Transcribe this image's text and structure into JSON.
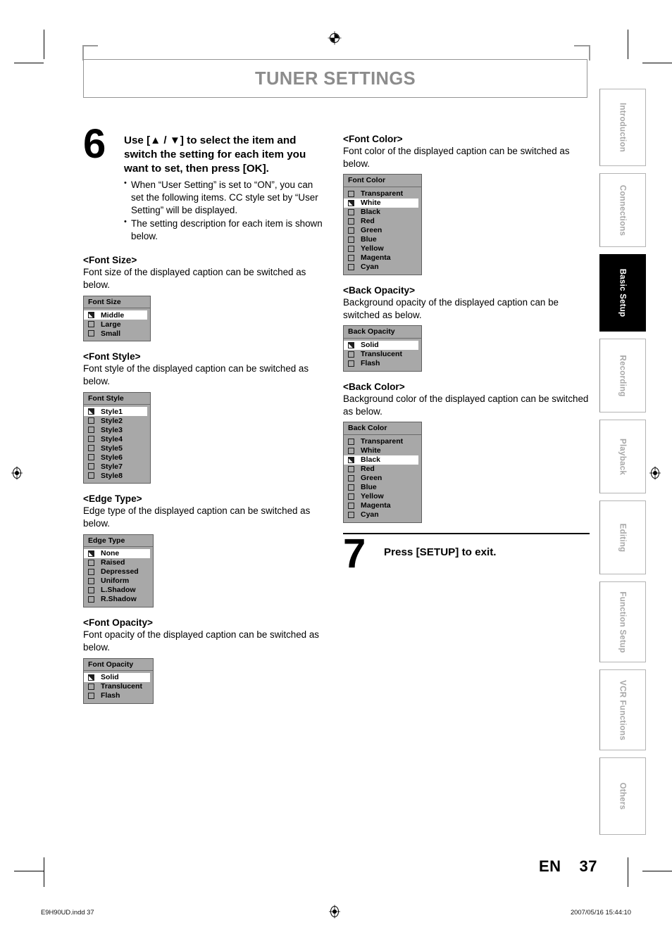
{
  "header": {
    "title": "TUNER SETTINGS"
  },
  "steps": {
    "six": {
      "number": "6",
      "heading": "Use [▲ / ▼] to select the item and switch the setting for each item you want to set, then press [OK].",
      "bullets": [
        "When “User Setting” is set to “ON”, you can set the following items. CC style set by “User Setting” will be displayed.",
        "The setting description for each item is shown below."
      ]
    },
    "seven": {
      "number": "7",
      "heading": "Press [SETUP] to exit."
    }
  },
  "sections": [
    {
      "title": "<Font Size>",
      "description": "Font size of the displayed caption can be switched as below.",
      "menu_title": "Font Size",
      "options": [
        {
          "label": "Middle",
          "checked": true
        },
        {
          "label": "Large",
          "checked": false
        },
        {
          "label": "Small",
          "checked": false
        }
      ]
    },
    {
      "title": "<Font Style>",
      "description": "Font style of the displayed caption can be switched as below.",
      "menu_title": "Font Style",
      "options": [
        {
          "label": "Style1",
          "checked": true
        },
        {
          "label": "Style2",
          "checked": false
        },
        {
          "label": "Style3",
          "checked": false
        },
        {
          "label": "Style4",
          "checked": false
        },
        {
          "label": "Style5",
          "checked": false
        },
        {
          "label": "Style6",
          "checked": false
        },
        {
          "label": "Style7",
          "checked": false
        },
        {
          "label": "Style8",
          "checked": false
        }
      ]
    },
    {
      "title": "<Edge Type>",
      "description": "Edge type of the displayed caption can be switched as below.",
      "menu_title": "Edge Type",
      "options": [
        {
          "label": "None",
          "checked": true
        },
        {
          "label": "Raised",
          "checked": false
        },
        {
          "label": "Depressed",
          "checked": false
        },
        {
          "label": "Uniform",
          "checked": false
        },
        {
          "label": "L.Shadow",
          "checked": false
        },
        {
          "label": "R.Shadow",
          "checked": false
        }
      ]
    },
    {
      "title": "<Font Opacity>",
      "description": "Font opacity of the displayed caption can be switched as below.",
      "menu_title": "Font Opacity",
      "options": [
        {
          "label": "Solid",
          "checked": true
        },
        {
          "label": "Translucent",
          "checked": false
        },
        {
          "label": "Flash",
          "checked": false
        }
      ]
    },
    {
      "title": "<Font Color>",
      "description": "Font color of the displayed caption can be switched as below.",
      "menu_title": "Font Color",
      "options": [
        {
          "label": "Transparent",
          "checked": false
        },
        {
          "label": "White",
          "checked": true
        },
        {
          "label": "Black",
          "checked": false
        },
        {
          "label": "Red",
          "checked": false
        },
        {
          "label": "Green",
          "checked": false
        },
        {
          "label": "Blue",
          "checked": false
        },
        {
          "label": "Yellow",
          "checked": false
        },
        {
          "label": "Magenta",
          "checked": false
        },
        {
          "label": "Cyan",
          "checked": false
        }
      ]
    },
    {
      "title": "<Back Opacity>",
      "description": "Background opacity of the displayed caption can be switched as below.",
      "menu_title": "Back Opacity",
      "options": [
        {
          "label": "Solid",
          "checked": true
        },
        {
          "label": "Translucent",
          "checked": false
        },
        {
          "label": "Flash",
          "checked": false
        }
      ]
    },
    {
      "title": "<Back Color>",
      "description": "Background color of the displayed caption can be switched as below.",
      "menu_title": "Back Color",
      "options": [
        {
          "label": "Transparent",
          "checked": false
        },
        {
          "label": "White",
          "checked": false
        },
        {
          "label": "Black",
          "checked": true
        },
        {
          "label": "Red",
          "checked": false
        },
        {
          "label": "Green",
          "checked": false
        },
        {
          "label": "Blue",
          "checked": false
        },
        {
          "label": "Yellow",
          "checked": false
        },
        {
          "label": "Magenta",
          "checked": false
        },
        {
          "label": "Cyan",
          "checked": false
        }
      ]
    }
  ],
  "side_tabs": [
    {
      "label": "Introduction",
      "active": false
    },
    {
      "label": "Connections",
      "active": false
    },
    {
      "label": "Basic Setup",
      "active": true
    },
    {
      "label": "Recording",
      "active": false
    },
    {
      "label": "Playback",
      "active": false
    },
    {
      "label": "Editing",
      "active": false
    },
    {
      "label": "Function Setup",
      "active": false
    },
    {
      "label": "VCR Functions",
      "active": false
    },
    {
      "label": "Others",
      "active": false
    }
  ],
  "footer": {
    "language": "EN",
    "page_number": "37",
    "file_name": "E9H90UD.indd  37",
    "timestamp": "2007/05/16  15:44:10"
  },
  "colors": {
    "title_gray": "#8c8c8c",
    "osd_background": "#a8a8a8",
    "osd_selected": "#ffffff",
    "tab_inactive_text": "#a8a8a8",
    "tab_active_background": "#000000"
  }
}
